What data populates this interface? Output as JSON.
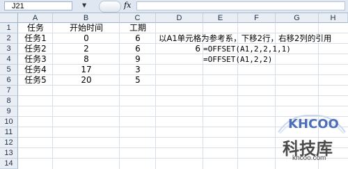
{
  "formula_bar": {
    "name_box": "J21",
    "fx_label": "fx",
    "formula": ""
  },
  "columns": [
    "A",
    "B",
    "C",
    "D",
    "E",
    "F",
    "G",
    "H"
  ],
  "rows": [
    "1",
    "2",
    "3",
    "4",
    "5",
    "6",
    "7",
    "8",
    "9",
    "10",
    "11",
    "12",
    "13",
    "14"
  ],
  "cells": {
    "A1": "任务",
    "B1": "开始时间",
    "C1": "工期",
    "A2": "任务1",
    "B2": "0",
    "C2": "6",
    "A3": "任务2",
    "B3": "2",
    "C3": "6",
    "A4": "任务3",
    "B4": "8",
    "C4": "9",
    "A5": "任务4",
    "B5": "17",
    "C5": "3",
    "A6": "任务5",
    "B6": "20",
    "C6": "5",
    "D2": "以A1单元格为参考系，下移2行，右移2列的引用",
    "D3_value": "6",
    "E3": "=OFFSET(A1,2,2,1,1)",
    "E4": "=OFFSET(A1,2,2)"
  },
  "watermark": {
    "logo": "KHCOO",
    "cn": "科技库",
    "url": "khcoo.com"
  }
}
